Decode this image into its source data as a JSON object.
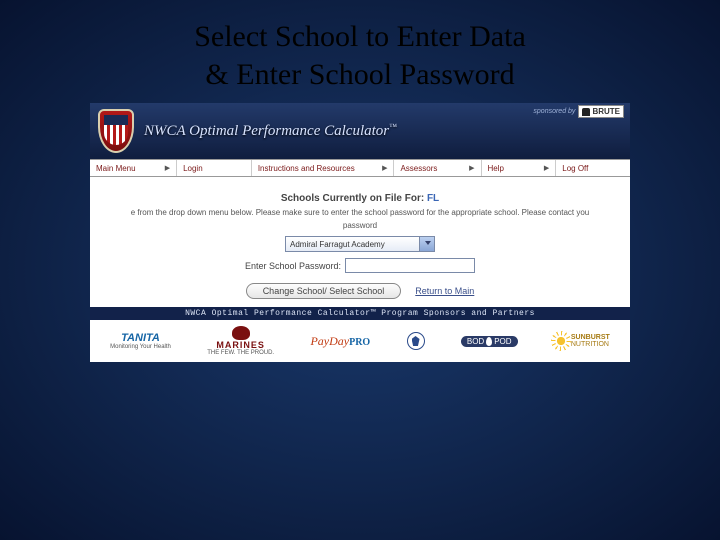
{
  "slide": {
    "title_line1": "Select School to Enter Data",
    "title_line2": "& Enter School Password"
  },
  "header": {
    "app_title": "NWCA Optimal Performance Calculator",
    "tm": "™",
    "sponsored_label": "sponsored by",
    "sponsor_logo_text": "BRUTE"
  },
  "nav": {
    "items": [
      {
        "label": "Main Menu"
      },
      {
        "label": "Login"
      },
      {
        "label": "Instructions and Resources"
      },
      {
        "label": "Assessors"
      },
      {
        "label": "Help"
      },
      {
        "label": "Log Off"
      }
    ]
  },
  "content": {
    "schools_prefix": "Schools Currently on File For: ",
    "state_code": "FL",
    "instruction": "e from the drop down menu below. Please make sure to enter the school password for the appropriate school. Please contact you",
    "instruction2": "password",
    "school_select_value": "Admiral Farragut Academy",
    "password_label": "Enter School Password:",
    "button_label": "Change School/ Select School",
    "return_link": "Return to Main"
  },
  "sponsor_bar": "NWCA Optimal Performance Calculator™ Program Sponsors and Partners",
  "sponsors": {
    "tanita": {
      "name": "TANITA",
      "tag": "Monitoring Your Health"
    },
    "marines": {
      "name": "MARINES",
      "tag": "THE FEW. THE PROUD."
    },
    "payday": {
      "name": "PayDay",
      "suffix": "PRO"
    },
    "bodpod": {
      "name": "BOD",
      "name2": "POD"
    },
    "sunburst": {
      "name": "SUNBURST",
      "tag": "NUTRITION"
    }
  }
}
